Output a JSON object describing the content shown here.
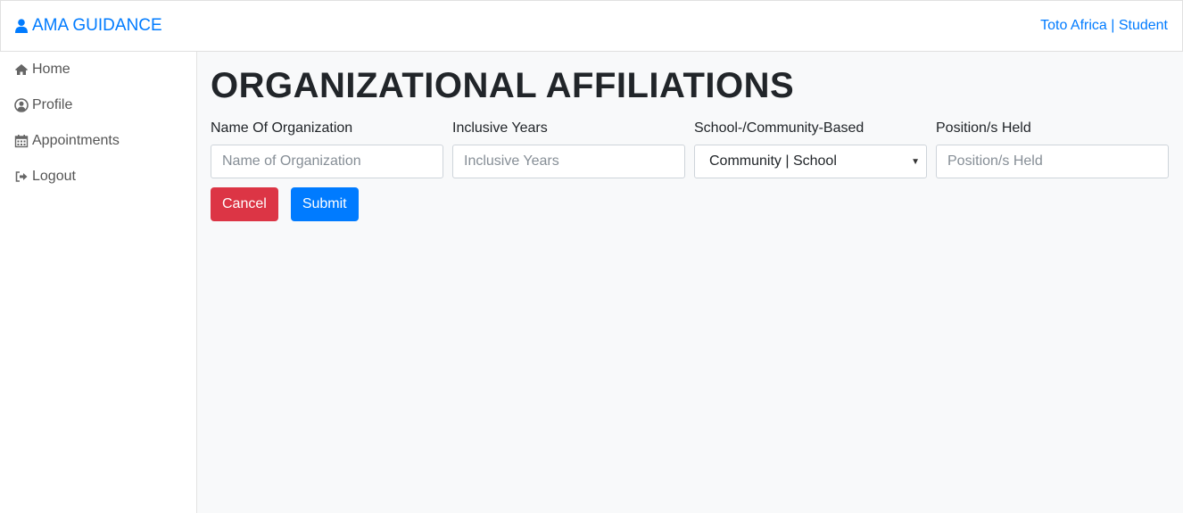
{
  "navbar": {
    "brand": "AMA GUIDANCE",
    "user": "Toto Africa | Student",
    "brand_color": "#007bff"
  },
  "sidebar": {
    "items": [
      {
        "label": "Home",
        "icon": "home-icon"
      },
      {
        "label": "Profile",
        "icon": "user-circle-icon"
      },
      {
        "label": "Appointments",
        "icon": "calendar-icon"
      },
      {
        "label": "Logout",
        "icon": "sign-out-icon"
      }
    ]
  },
  "main": {
    "title": "ORGANIZATIONAL AFFILIATIONS",
    "fields": {
      "organization": {
        "label": "Name Of Organization",
        "placeholder": "Name of Organization"
      },
      "years": {
        "label": "Inclusive Years",
        "placeholder": "Inclusive Years"
      },
      "type": {
        "label": "School-/Community-Based",
        "value": "Community | School"
      },
      "position": {
        "label": "Position/s Held",
        "placeholder": "Position/s Held"
      }
    },
    "buttons": {
      "cancel": "Cancel",
      "submit": "Submit"
    },
    "colors": {
      "cancel": "#dc3545",
      "submit": "#007bff"
    }
  }
}
